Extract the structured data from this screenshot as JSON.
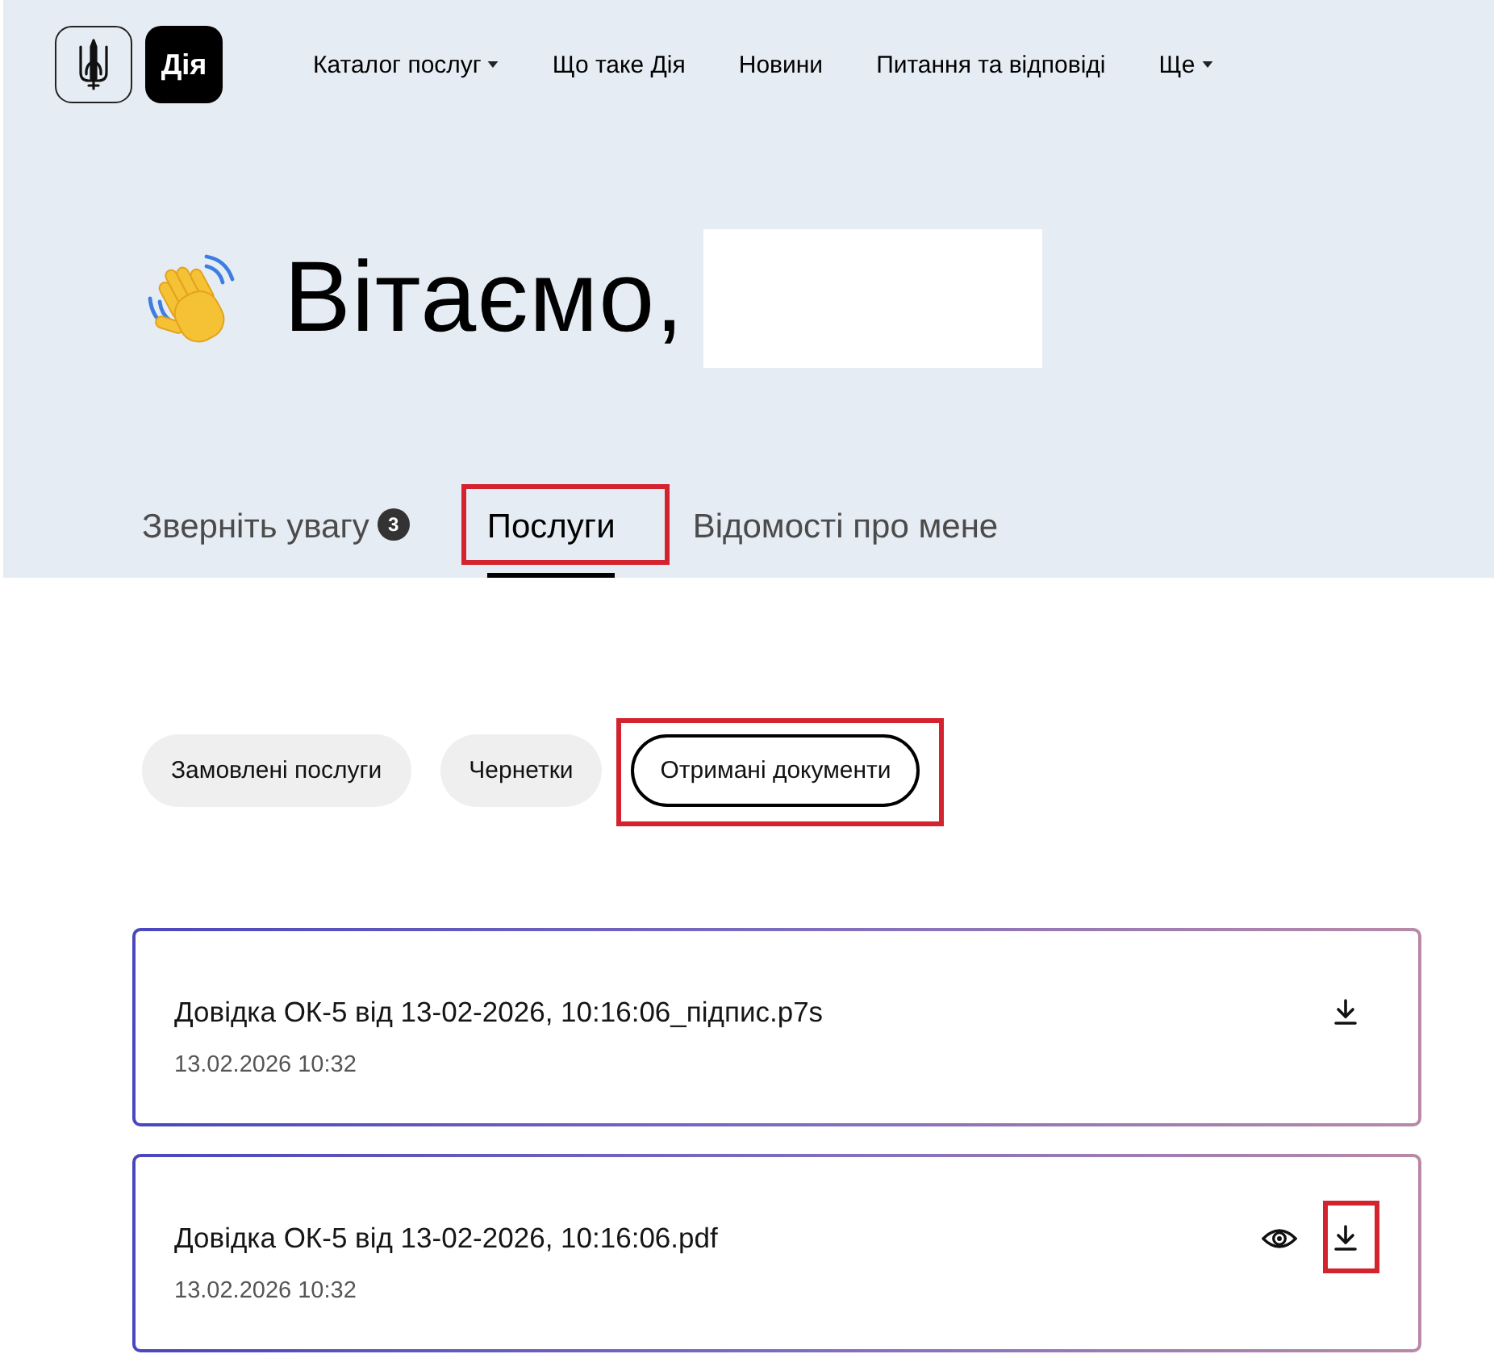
{
  "header": {
    "brand": "Дія",
    "nav": [
      {
        "label": "Каталог послуг",
        "has_menu": true
      },
      {
        "label": "Що таке Дія",
        "has_menu": false
      },
      {
        "label": "Новини",
        "has_menu": false
      },
      {
        "label": "Питання та відповіді",
        "has_menu": false
      },
      {
        "label": "Ще",
        "has_menu": true
      }
    ]
  },
  "greeting": {
    "text": "Вітаємо,",
    "name_redacted": true
  },
  "tabs": [
    {
      "label": "Зверніть увагу",
      "badge": "3",
      "selected": false,
      "highlighted": false
    },
    {
      "label": "Послуги",
      "selected": true,
      "highlighted": true
    },
    {
      "label": "Відомості про мене",
      "selected": false,
      "highlighted": false
    }
  ],
  "filters": [
    {
      "label": "Замовлені послуги",
      "selected": false,
      "highlighted": false
    },
    {
      "label": "Чернетки",
      "selected": false,
      "highlighted": false
    },
    {
      "label": "Отримані документи",
      "selected": true,
      "highlighted": true
    }
  ],
  "documents": [
    {
      "title": "Довідка ОК-5 від 13-02-2026, 10:16:06_підпис.p7s",
      "date": "13.02.2026 10:32",
      "actions": [
        {
          "kind": "download",
          "highlighted": false
        }
      ]
    },
    {
      "title": "Довідка ОК-5 від 13-02-2026, 10:16:06.pdf",
      "date": "13.02.2026 10:32",
      "actions": [
        {
          "kind": "view",
          "highlighted": false
        },
        {
          "kind": "download",
          "highlighted": true
        }
      ]
    }
  ]
}
